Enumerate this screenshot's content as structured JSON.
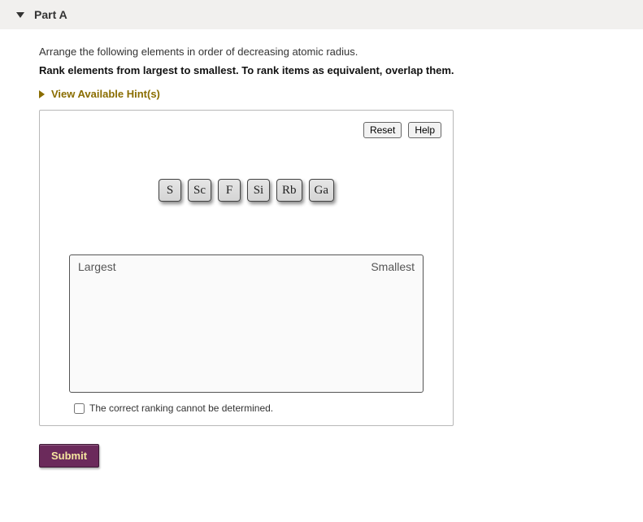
{
  "header": {
    "title": "Part A"
  },
  "content": {
    "instruction": "Arrange the following elements in order of decreasing atomic radius.",
    "bold_instruction": "Rank elements from largest to smallest. To rank items as equivalent, overlap them.",
    "hints_label": "View Available Hint(s)"
  },
  "workspace": {
    "reset_label": "Reset",
    "help_label": "Help",
    "tiles": [
      "S",
      "Sc",
      "F",
      "Si",
      "Rb",
      "Ga"
    ],
    "dropzone": {
      "left_label": "Largest",
      "right_label": "Smallest"
    },
    "checkbox_label": "The correct ranking cannot be determined."
  },
  "footer": {
    "submit_label": "Submit"
  }
}
